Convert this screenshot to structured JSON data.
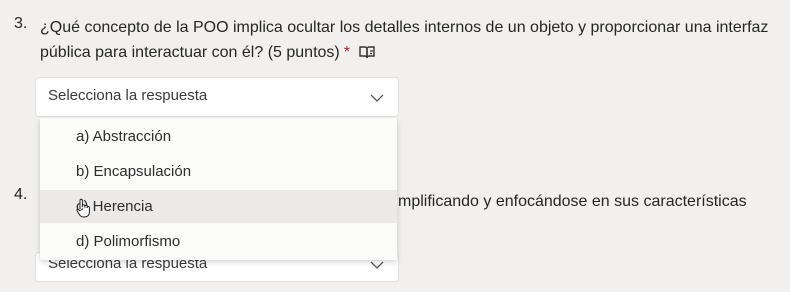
{
  "question3": {
    "number": "3.",
    "text": "¿Qué concepto de la POO implica ocultar los detalles internos de un objeto y proporcionar una interfaz pública para interactuar con él? (5 puntos)",
    "required_mark": "*",
    "reader_icon": "immersive-reader-icon",
    "select": {
      "placeholder": "Selecciona la respuesta",
      "icon": "chevron-down-icon",
      "options": [
        "a) Abstracción",
        "b) Encapsulación",
        "c) Herencia",
        "d) Polimorfismo"
      ]
    }
  },
  "question4": {
    "number": "4.",
    "text_visible": "mplificando y enfocándose en sus características",
    "select": {
      "placeholder": "Selecciona la respuesta",
      "icon": "chevron-down-icon"
    }
  },
  "colors": {
    "background": "#f1f0ee",
    "required": "#a4262c",
    "option_hover": "#ebeae8"
  },
  "cursor": "hand-pointer-icon"
}
